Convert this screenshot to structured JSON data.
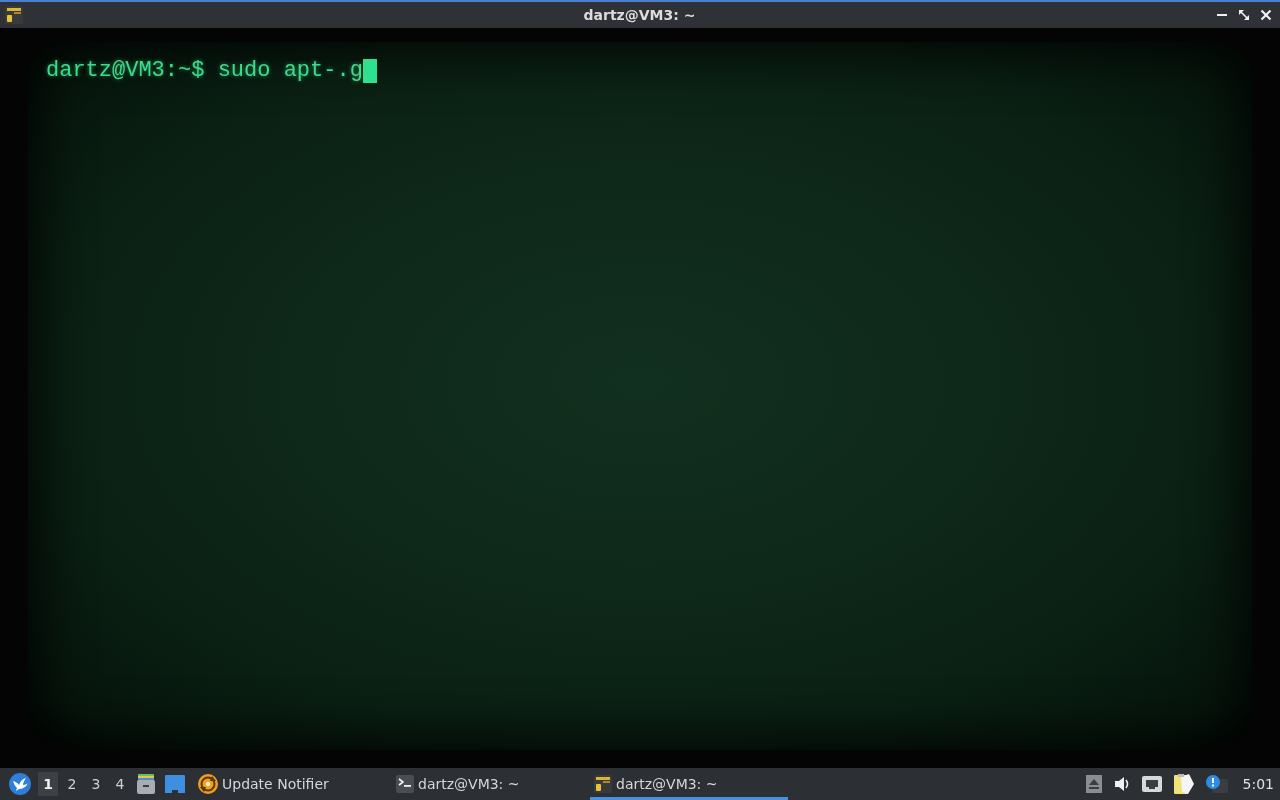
{
  "window": {
    "title": "dartz@VM3: ~"
  },
  "terminal": {
    "lines": [
      "dartz@VM3:~$ sudo apt-.g"
    ]
  },
  "taskbar": {
    "workspaces": [
      {
        "label": "1",
        "selected": true
      },
      {
        "label": "2",
        "selected": false
      },
      {
        "label": "3",
        "selected": false
      },
      {
        "label": "4",
        "selected": false
      }
    ],
    "tasks": [
      {
        "label": "Update Notifier",
        "kind": "notifier",
        "selected": false
      },
      {
        "label": "dartz@VM3: ~",
        "kind": "terminal",
        "selected": false
      },
      {
        "label": "dartz@VM3: ~",
        "kind": "crt",
        "selected": true
      }
    ],
    "clock": "5:01"
  }
}
